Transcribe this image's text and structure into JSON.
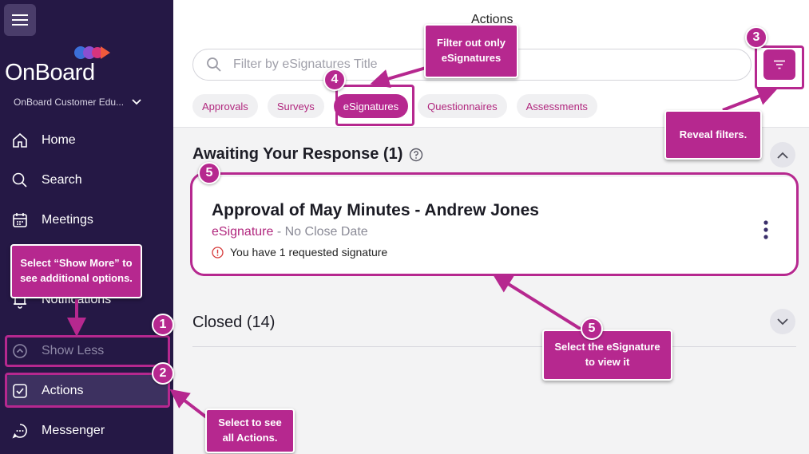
{
  "app": {
    "brand": "OnBoard",
    "org_name": "OnBoard Customer Edu...",
    "page_title": "Actions",
    "accent_color": "#b6288f",
    "sidebar_color": "#251845"
  },
  "sidebar": {
    "items": [
      {
        "label": "Home",
        "icon": "home-icon"
      },
      {
        "label": "Search",
        "icon": "search-icon"
      },
      {
        "label": "Meetings",
        "icon": "calendar-icon"
      },
      {
        "label": "Notifications",
        "icon": "bell-icon"
      },
      {
        "label": "Show Less",
        "icon": "chevron-up-circle-icon"
      },
      {
        "label": "Actions",
        "icon": "checkbox-icon"
      },
      {
        "label": "Messenger",
        "icon": "chat-icon"
      }
    ]
  },
  "search": {
    "placeholder": "Filter by eSignatures Title"
  },
  "filters": {
    "chips": [
      "Approvals",
      "Surveys",
      "eSignatures",
      "Questionnaires",
      "Assessments"
    ],
    "active": "eSignatures"
  },
  "awaiting": {
    "title": "Awaiting Your Response (1)",
    "card": {
      "title": "Approval of May Minutes - Andrew Jones",
      "type": "eSignature",
      "close_info": " - No Close Date",
      "request": "You have 1 requested signature"
    }
  },
  "closed": {
    "title": "Closed (14)"
  },
  "annotations": {
    "show_more": "Select “Show More” to see additional options.",
    "select_actions": "Select to see all Actions.",
    "filter_esig": "Filter out only eSignatures",
    "reveal_filters": "Reveal filters.",
    "select_esig": "Select the eSignature to view it",
    "badges": [
      "1",
      "2",
      "3",
      "4",
      "5",
      "5"
    ]
  }
}
